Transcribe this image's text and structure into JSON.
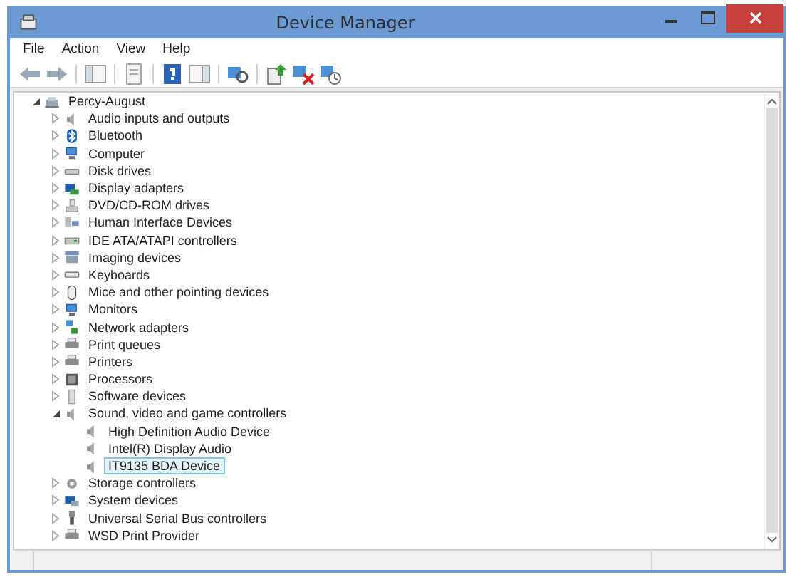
{
  "window": {
    "title": "Device Manager"
  },
  "menu": [
    {
      "label": "File"
    },
    {
      "label": "Action"
    },
    {
      "label": "View"
    },
    {
      "label": "Help"
    }
  ],
  "toolbar": [
    {
      "kind": "back"
    },
    {
      "kind": "forward"
    },
    {
      "kind": "separator"
    },
    {
      "kind": "console-tree"
    },
    {
      "kind": "separator"
    },
    {
      "kind": "properties"
    },
    {
      "kind": "separator"
    },
    {
      "kind": "help"
    },
    {
      "kind": "action-pane"
    },
    {
      "kind": "separator"
    },
    {
      "kind": "scan"
    },
    {
      "kind": "separator"
    },
    {
      "kind": "update"
    },
    {
      "kind": "uninstall"
    },
    {
      "kind": "enable"
    }
  ],
  "tree": {
    "label": "Percy-August",
    "kind": "computer",
    "expanded": true,
    "selected": false,
    "children": [
      {
        "label": "Audio inputs and outputs",
        "kind": "speaker",
        "expanded": false,
        "selected": false
      },
      {
        "label": "Bluetooth",
        "kind": "bluetooth",
        "expanded": false,
        "selected": false
      },
      {
        "label": "Computer",
        "kind": "monitor",
        "expanded": false,
        "selected": false
      },
      {
        "label": "Disk drives",
        "kind": "disk",
        "expanded": false,
        "selected": false
      },
      {
        "label": "Display adapters",
        "kind": "display",
        "expanded": false,
        "selected": false
      },
      {
        "label": "DVD/CD-ROM drives",
        "kind": "dvd",
        "expanded": false,
        "selected": false
      },
      {
        "label": "Human Interface Devices",
        "kind": "hid",
        "expanded": false,
        "selected": false
      },
      {
        "label": "IDE ATA/ATAPI controllers",
        "kind": "ide",
        "expanded": false,
        "selected": false
      },
      {
        "label": "Imaging devices",
        "kind": "imaging",
        "expanded": false,
        "selected": false
      },
      {
        "label": "Keyboards",
        "kind": "keyboard",
        "expanded": false,
        "selected": false
      },
      {
        "label": "Mice and other pointing devices",
        "kind": "mouse",
        "expanded": false,
        "selected": false
      },
      {
        "label": "Monitors",
        "kind": "monitor",
        "expanded": false,
        "selected": false
      },
      {
        "label": "Network adapters",
        "kind": "network",
        "expanded": false,
        "selected": false
      },
      {
        "label": "Print queues",
        "kind": "printer",
        "expanded": false,
        "selected": false
      },
      {
        "label": "Printers",
        "kind": "printer",
        "expanded": false,
        "selected": false
      },
      {
        "label": "Processors",
        "kind": "processor",
        "expanded": false,
        "selected": false
      },
      {
        "label": "Software devices",
        "kind": "software",
        "expanded": false,
        "selected": false
      },
      {
        "label": "Sound, video and game controllers",
        "kind": "speaker",
        "expanded": true,
        "selected": false,
        "children": [
          {
            "label": "High Definition Audio Device",
            "kind": "speaker",
            "selected": false
          },
          {
            "label": "Intel(R) Display Audio",
            "kind": "speaker",
            "selected": false
          },
          {
            "label": "IT9135 BDA Device",
            "kind": "speaker",
            "selected": true
          }
        ]
      },
      {
        "label": "Storage controllers",
        "kind": "storage",
        "expanded": false,
        "selected": false
      },
      {
        "label": "System devices",
        "kind": "system",
        "expanded": false,
        "selected": false
      },
      {
        "label": "Universal Serial Bus controllers",
        "kind": "usb",
        "expanded": false,
        "selected": false
      },
      {
        "label": "WSD Print Provider",
        "kind": "printer",
        "expanded": false,
        "selected": false
      }
    ]
  }
}
